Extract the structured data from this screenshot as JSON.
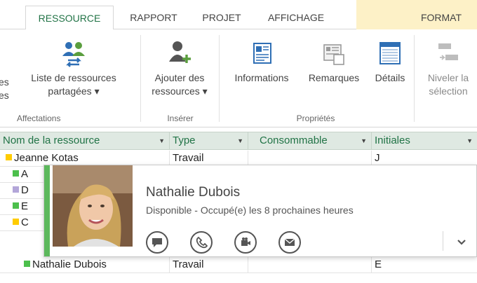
{
  "tabs": [
    {
      "label": "RESSOURCE",
      "active": true
    },
    {
      "label": "RAPPORT"
    },
    {
      "label": "PROJET"
    },
    {
      "label": "AFFICHAGE"
    },
    {
      "label": "FORMAT"
    }
  ],
  "colors": {
    "accent": "#217346",
    "header_bg": "#dfe9e2",
    "presence_available": "#5cb85c",
    "format_tab_bg": "#fdf1c7",
    "icon_blue": "#2f6fb5",
    "icon_green": "#5a9e3e",
    "marker_yellow": "#ffcc00",
    "marker_green": "#4cbf4c",
    "marker_lilac": "#b3a6d9"
  },
  "ribbon": {
    "clipped_left_line1": "es",
    "clipped_left_line2": "es",
    "shared_resources": {
      "line1": "Liste de ressources",
      "line2": "partagées ▾",
      "icon": "shared-resources-icon"
    },
    "group_affectations": "Affectations",
    "add_resources": {
      "line1": "Ajouter des",
      "line2": "ressources ▾",
      "icon": "add-resource-icon"
    },
    "group_inserer": "Insérer",
    "informations": {
      "label": "Informations",
      "icon": "information-card-icon"
    },
    "remarques": {
      "label": "Remarques",
      "icon": "notes-icon"
    },
    "details": {
      "label": "Détails",
      "icon": "details-icon"
    },
    "group_proprietes": "Propriétés",
    "level_selection": {
      "line1": "Niveler la",
      "line2": "sélection",
      "icon": "level-selection-icon"
    }
  },
  "grid": {
    "columns": [
      {
        "label": "Nom de la ressource"
      },
      {
        "label": "Type"
      },
      {
        "label": "Consommable"
      },
      {
        "label": "Initiales"
      },
      {
        "label": ""
      }
    ],
    "rows": [
      {
        "name": "Jeanne Kotas",
        "type": "Travail",
        "consumable": "",
        "initials": "J",
        "marker": "#ffcc00"
      },
      {
        "name": "A",
        "type": "",
        "consumable": "",
        "initials": "",
        "marker": "#4cbf4c"
      },
      {
        "name": "D",
        "type": "",
        "consumable": "",
        "initials": "",
        "marker": "#b3a6d9"
      },
      {
        "name": "E",
        "type": "",
        "consumable": "",
        "initials": "",
        "marker": "#4cbf4c"
      },
      {
        "name": "C",
        "type": "",
        "consumable": "",
        "initials": "",
        "marker": "#ffcc00"
      },
      {
        "name": "Nathalie Dubois",
        "type": "Travail",
        "consumable": "",
        "initials": "E",
        "marker": "#4cbf4c"
      }
    ]
  },
  "contact_card": {
    "name": "Nathalie Dubois",
    "status": "Disponible - Occupé(e) les 8 prochaines heures",
    "actions": [
      "chat-icon",
      "phone-icon",
      "video-icon",
      "email-icon"
    ],
    "expand": "chevron-down-icon"
  }
}
